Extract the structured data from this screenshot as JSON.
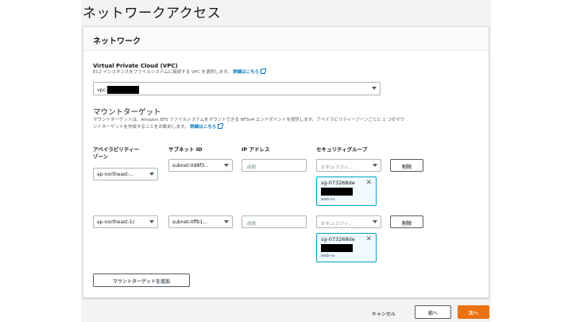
{
  "page": {
    "title": "ネットワークアクセス"
  },
  "panel": {
    "title": "ネットワーク",
    "vpc": {
      "label": "Virtual Private Cloud (VPC)",
      "description": "EC2 インスタンスをファイルシステムに接続する VPC を選択します。",
      "link": "詳細はこちら",
      "value_prefix": "vpc-"
    },
    "mount": {
      "heading": "マウントターゲット",
      "description_1": "マウントターゲットは、Amazon EFS ファイルシステムをマウントできる NFSv4 エンドポイントを提供します。アベイラビリティーゾーンごとに 1 つのマウ",
      "description_2": "ントターゲットを作成することをお勧めします。",
      "link": "詳細はこちら",
      "columns": {
        "az_1": "アベイラビリティー",
        "az_2": "ゾーン",
        "subnet": "サブネット ID",
        "ip": "IP アドレス",
        "sg": "セキュリティグループ"
      },
      "rows": [
        {
          "az": "ap-northeast-...",
          "subnet": "subnet-0d8f3...",
          "ip_placeholder": "自動",
          "sg_placeholder": "セキュリティ...",
          "remove": "削除",
          "token": {
            "id": "sg-073268de",
            "name": "web-sv"
          }
        },
        {
          "az": "ap-northeast-1c",
          "subnet": "subnet-0ffb1...",
          "ip_placeholder": "自動",
          "sg_placeholder": "セキュリティ...",
          "remove": "削除",
          "token": {
            "id": "sg-073268de",
            "name": "web-sv"
          }
        }
      ],
      "add_button": "マウントターゲットを追加"
    }
  },
  "footer": {
    "cancel": "キャンセル",
    "back": "前へ",
    "next": "次へ"
  },
  "icons": {
    "remove_token": "close-icon",
    "dropdown": "caret-down-icon",
    "external": "external-link-icon"
  },
  "colors": {
    "primary": "#ec7211",
    "link": "#0073bb",
    "token_border": "#00a1c9"
  }
}
